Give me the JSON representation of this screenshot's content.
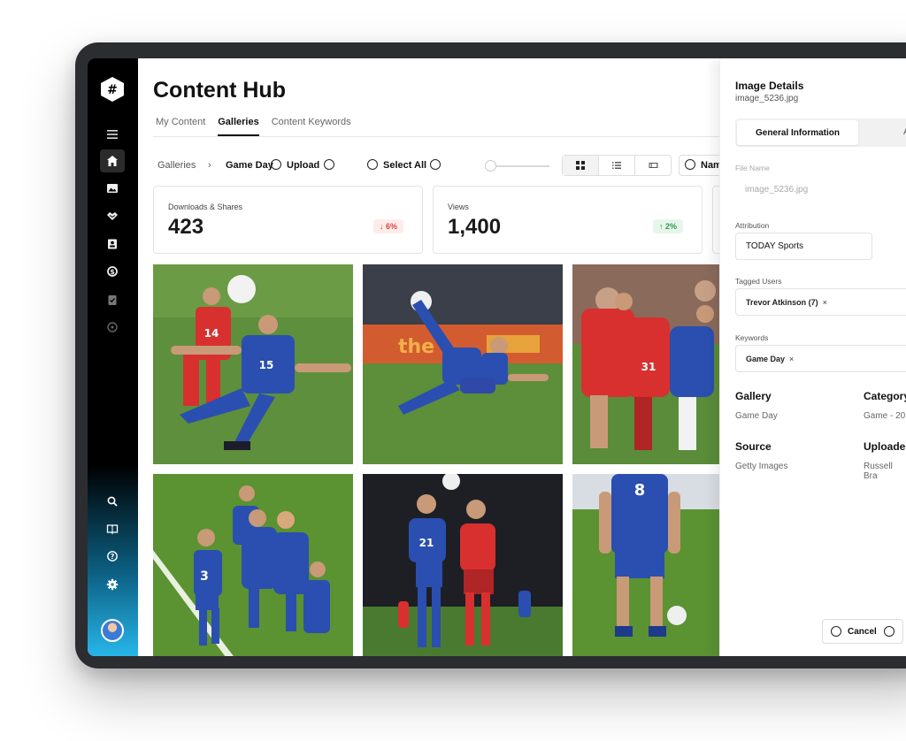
{
  "app": {
    "logo_glyph": "#",
    "page_title": "Content Hub"
  },
  "tabs": [
    "My Content",
    "Galleries",
    "Content Keywords"
  ],
  "toolbar": {
    "breadcrumb_root": "Galleries",
    "breadcrumb_sep": "›",
    "breadcrumb_current": "Game Day",
    "upload_label": "Upload",
    "select_all_label": "Select All",
    "sort_label": "Name A-"
  },
  "stats": [
    {
      "label": "Downloads & Shares",
      "value": "423",
      "delta": "↓ 6%",
      "trend": "down"
    },
    {
      "label": "Views",
      "value": "1,400",
      "delta": "↑ 2%",
      "trend": "up"
    }
  ],
  "gallery": {
    "photos": [
      {
        "scene": "header-duel",
        "jersey_numbers": [
          "14",
          "15"
        ]
      },
      {
        "scene": "bicycle-kick",
        "jersey_numbers": []
      },
      {
        "scene": "tackle",
        "jersey_numbers": [
          "31"
        ]
      },
      {
        "scene": "team-celebration",
        "jersey_numbers": [
          "3"
        ]
      },
      {
        "scene": "night-header",
        "jersey_numbers": [
          "21"
        ]
      },
      {
        "scene": "player-back",
        "jersey_numbers": [
          "8"
        ]
      }
    ]
  },
  "panel": {
    "title": "Image Details",
    "file": "image_5236.jpg",
    "tab_general": "General Information",
    "tab_other": "A",
    "file_name_label": "File Name",
    "file_name_value": "image_5236.jpg",
    "attribution_label": "Attribution",
    "attribution_value": "TODAY Sports",
    "tagged_users_label": "Tagged Users",
    "tagged_user_chip": "Trevor Atkinson (7)",
    "keywords_label": "Keywords",
    "keyword_chip": "Game Day",
    "chip_remove": "×",
    "gallery_title": "Gallery",
    "gallery_value": "Game Day",
    "category_title": "Category",
    "category_value": "Game - 20",
    "source_title": "Source",
    "source_value": "Getty Images",
    "uploaded_title": "Uploaded",
    "uploaded_value": "Russell Bra",
    "cancel_label": "Cancel"
  },
  "colors": {
    "sidebar_top": "#000000",
    "sidebar_bottom": "#27b6ea",
    "pitch_green": "#5d8f3a",
    "team_red": "#d8302f",
    "team_blue": "#2a4fb0",
    "badge_down": "#d8473a",
    "badge_up": "#2f9b4e"
  },
  "icons": {
    "sidebar": [
      "menu-icon",
      "home-icon",
      "image-icon",
      "handshake-icon",
      "contacts-icon",
      "sync-icon",
      "clipboard-icon",
      "chat-icon",
      "search-icon",
      "book-icon",
      "help-icon",
      "gear-icon"
    ]
  }
}
